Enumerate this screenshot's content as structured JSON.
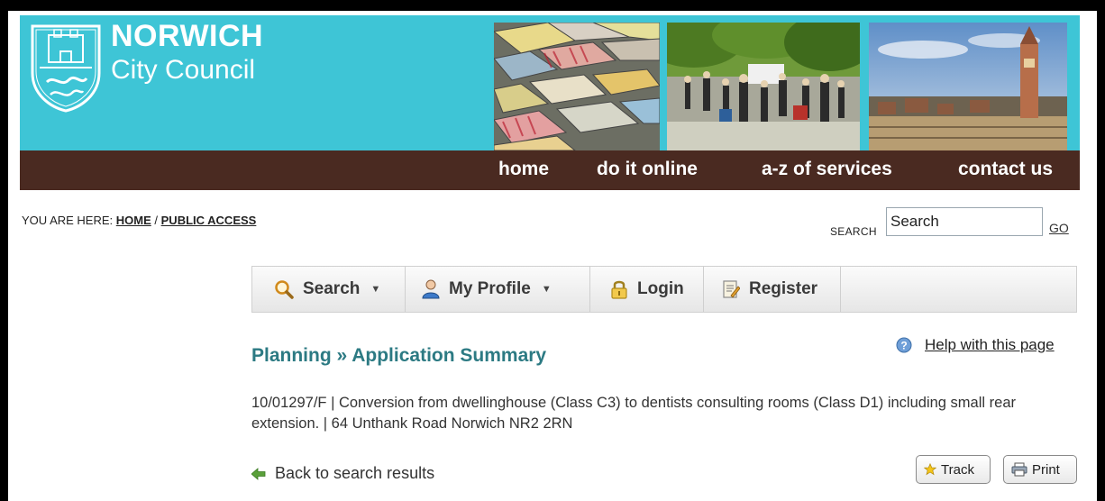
{
  "header": {
    "brand_line1": "NORWICH",
    "brand_line2": "City Council",
    "brand_color": "#3ec5d6",
    "nav_color": "#4a2a21",
    "nav": [
      "home",
      "do it online",
      "a-z of services",
      "contact us"
    ]
  },
  "breadcrumb": {
    "prefix": "YOU ARE HERE:",
    "home": "HOME",
    "separator": "/",
    "current": "PUBLIC ACCESS"
  },
  "site_search": {
    "label": "SEARCH",
    "value": "Search",
    "go": "GO"
  },
  "toolbar": {
    "search": "Search",
    "my_profile": "My Profile",
    "login": "Login",
    "register": "Register"
  },
  "page": {
    "title": "Planning » Application Summary",
    "help": "Help with this page",
    "summary": "10/01297/F | Conversion from dwellinghouse (Class C3) to dentists consulting rooms (Class D1) including small rear extension. | 64 Unthank Road Norwich NR2 2RN",
    "back": "Back to search results",
    "track": "Track",
    "print": "Print",
    "title_color": "#2c7a83"
  }
}
